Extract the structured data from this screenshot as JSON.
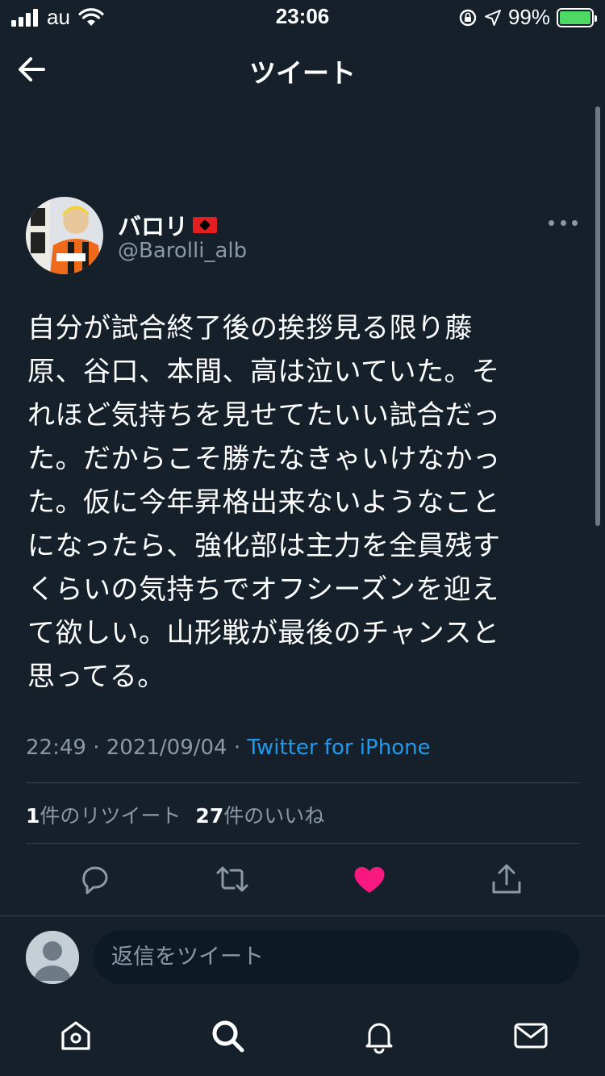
{
  "status_bar": {
    "carrier": "au",
    "time": "23:06",
    "battery_percent": "99%",
    "battery_level": 0.99
  },
  "nav": {
    "title": "ツイート"
  },
  "tweet": {
    "display_name": "バロリ",
    "handle": "@Barolli_alb",
    "text": "自分が試合終了後の挨拶見る限り藤\n原、谷口、本間、高は泣いていた。そ\nれほど気持ちを見せてたいい試合だっ\nた。だからこそ勝たなきゃいけなかっ\nた。仮に今年昇格出来ないようなこと\nになったら、強化部は主力を全員残す\nくらいの気持ちでオフシーズンを迎え\nて欲しい。山形戦が最後のチャンスと\n思ってる。",
    "time": "22:49",
    "date": "2021/09/04",
    "source": "Twitter for iPhone",
    "retweet_count": "1",
    "retweet_label": "件のリツイート",
    "like_count": "27",
    "like_label": "件のいいね",
    "liked": true
  },
  "reply": {
    "placeholder": "返信をツイート"
  },
  "colors": {
    "background": "#15202b",
    "accent": "#1d9bf0",
    "like": "#f91880",
    "muted": "#8b98a5",
    "divider": "#38444d"
  },
  "icons": {
    "back": "arrow-left-icon",
    "more": "more-horizontal-icon",
    "reply": "comment-icon",
    "retweet": "retweet-icon",
    "like": "heart-icon",
    "share": "share-icon",
    "home": "home-icon",
    "search": "search-icon",
    "notifications": "bell-icon",
    "messages": "mail-icon"
  }
}
